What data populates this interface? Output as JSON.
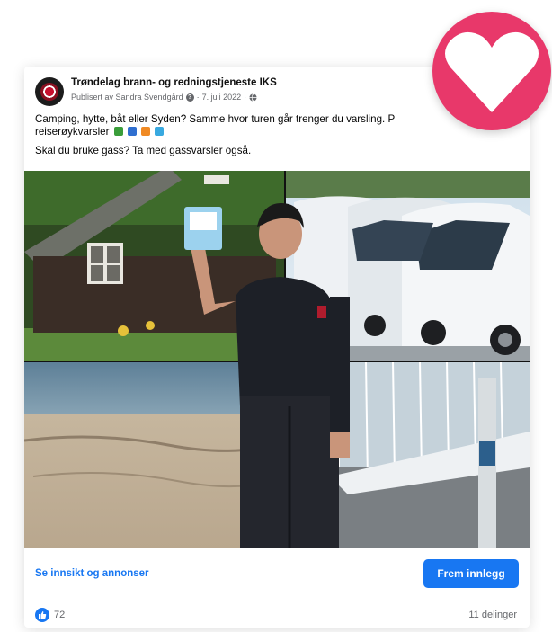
{
  "post": {
    "page_name": "Trøndelag brann- og redningstjeneste IKS",
    "author_line": "Publisert av Sandra Svendgård",
    "date": "7. juli 2022",
    "text_line1": "Camping, hytte, båt eller Syden? Samme hvor turen går trenger du varsling. P",
    "text_line2": "reiserøykvarsler",
    "text_line3": "Skal du bruke gass? Ta med gassvarsler også."
  },
  "actions": {
    "insight_link": "Se innsikt og annonser",
    "boost_button": "Frem innlegg"
  },
  "stats": {
    "likes": "72",
    "shares": "11 delinger"
  },
  "colors": {
    "accent": "#1877f2",
    "heart_badge": "#e8386a"
  },
  "icons": {
    "avatar": "fire-department-logo",
    "heart": "heart-icon",
    "like": "thumbs-up-icon",
    "privacy": "globe-icon"
  }
}
